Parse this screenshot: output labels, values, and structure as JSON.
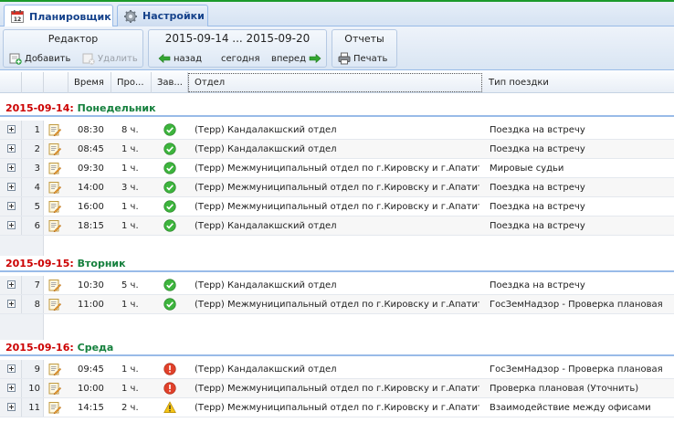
{
  "tabs": [
    {
      "label": "Планировщик",
      "active": true,
      "icon": "calendar-icon"
    },
    {
      "label": "Настройки",
      "active": false,
      "icon": "gear-icon"
    }
  ],
  "toolbar": {
    "editor": {
      "title": "Редактор",
      "add": "Добавить",
      "delete": "Удалить"
    },
    "range": {
      "title": "2015-09-14 ... 2015-09-20",
      "back": "назад",
      "today": "сегодня",
      "forward": "вперед"
    },
    "reports": {
      "title": "Отчеты",
      "print": "Печать"
    }
  },
  "columns": {
    "time": "Время",
    "duration": "Про...",
    "done": "Зав...",
    "dept": "Отдел",
    "trip": "Тип поездки"
  },
  "groups": [
    {
      "date": "2015-09-14",
      "sep": ":",
      "weekday": "Понедельник",
      "rows": [
        {
          "n": "1",
          "time": "08:30",
          "dur": "8 ч.",
          "status": "ok",
          "dept": "(Терр) Кандалакшский отдел",
          "trip": "Поездка на встречу"
        },
        {
          "n": "2",
          "time": "08:45",
          "dur": "1 ч.",
          "status": "ok",
          "dept": "(Терр) Кандалакшский отдел",
          "trip": "Поездка на встречу"
        },
        {
          "n": "3",
          "time": "09:30",
          "dur": "1 ч.",
          "status": "ok",
          "dept": "(Терр) Межмуниципальный отдел по г.Кировску и г.Апатиты",
          "trip": "Мировые судьи"
        },
        {
          "n": "4",
          "time": "14:00",
          "dur": "3 ч.",
          "status": "ok",
          "dept": "(Терр) Межмуниципальный отдел по г.Кировску и г.Апатиты",
          "trip": "Поездка на встречу"
        },
        {
          "n": "5",
          "time": "16:00",
          "dur": "1 ч.",
          "status": "ok",
          "dept": "(Терр) Межмуниципальный отдел по г.Кировску и г.Апатиты",
          "trip": "Поездка на встречу"
        },
        {
          "n": "6",
          "time": "18:15",
          "dur": "1 ч.",
          "status": "ok",
          "dept": "(Терр) Кандалакшский отдел",
          "trip": "Поездка на встречу"
        }
      ]
    },
    {
      "date": "2015-09-15",
      "sep": ":",
      "weekday": "Вторник",
      "rows": [
        {
          "n": "7",
          "time": "10:30",
          "dur": "5 ч.",
          "status": "ok",
          "dept": "(Терр) Кандалакшский отдел",
          "trip": "Поездка на встречу"
        },
        {
          "n": "8",
          "time": "11:00",
          "dur": "1 ч.",
          "status": "ok",
          "dept": "(Терр) Межмуниципальный отдел по г.Кировску и г.Апатиты",
          "trip": "ГосЗемНадзор - Проверка плановая"
        }
      ]
    },
    {
      "date": "2015-09-16",
      "sep": ":",
      "weekday": "Среда",
      "rows": [
        {
          "n": "9",
          "time": "09:45",
          "dur": "1 ч.",
          "status": "error",
          "dept": "(Терр) Кандалакшский отдел",
          "trip": "ГосЗемНадзор - Проверка плановая"
        },
        {
          "n": "10",
          "time": "10:00",
          "dur": "1 ч.",
          "status": "error",
          "dept": "(Терр) Межмуниципальный отдел по г.Кировску и г.Апатиты",
          "trip": "Проверка плановая (Уточнить)"
        },
        {
          "n": "11",
          "time": "14:15",
          "dur": "2 ч.",
          "status": "warning",
          "dept": "(Терр) Межмуниципальный отдел по г.Кировску и г.Апатиты",
          "trip": "Взаимодействие между офисами"
        }
      ]
    }
  ]
}
